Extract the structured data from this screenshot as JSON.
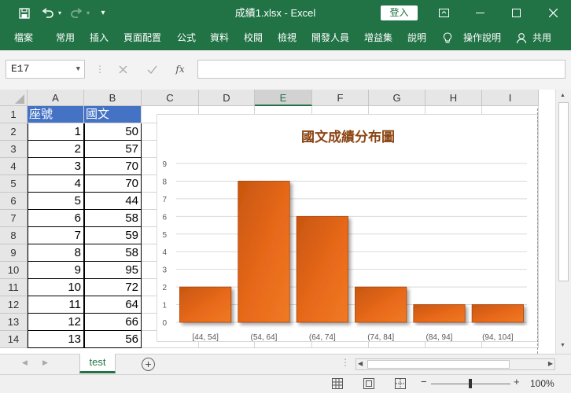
{
  "app": {
    "title": "成績1.xlsx  -  Excel",
    "signin_label": "登入"
  },
  "ribbon": {
    "tabs": [
      "檔案",
      "常用",
      "插入",
      "頁面配置",
      "公式",
      "資料",
      "校閱",
      "檢視",
      "開發人員",
      "增益集",
      "說明",
      "操作說明",
      "共用"
    ]
  },
  "formula_bar": {
    "name_box": "E17",
    "fx_label": "fx",
    "formula": ""
  },
  "grid": {
    "columns": [
      "A",
      "B",
      "C",
      "D",
      "E",
      "F",
      "G",
      "H",
      "I"
    ],
    "selected_column": "E",
    "rows": [
      "1",
      "2",
      "3",
      "4",
      "5",
      "6",
      "7",
      "8",
      "9",
      "10",
      "11",
      "12",
      "13",
      "14"
    ],
    "header_row": [
      "座號",
      "國文"
    ],
    "data": [
      [
        "1",
        "50"
      ],
      [
        "2",
        "57"
      ],
      [
        "3",
        "70"
      ],
      [
        "4",
        "70"
      ],
      [
        "5",
        "44"
      ],
      [
        "6",
        "58"
      ],
      [
        "7",
        "59"
      ],
      [
        "8",
        "58"
      ],
      [
        "9",
        "95"
      ],
      [
        "10",
        "72"
      ],
      [
        "11",
        "64"
      ],
      [
        "12",
        "66"
      ],
      [
        "13",
        "56"
      ]
    ]
  },
  "chart_data": {
    "type": "bar",
    "title": "國文成績分布圖",
    "categories": [
      "[44, 54]",
      "(54, 64]",
      "(64, 74]",
      "(74, 84]",
      "(84, 94]",
      "(94, 104]"
    ],
    "values": [
      2,
      8,
      6,
      2,
      1,
      1
    ],
    "ylim": [
      0,
      9
    ],
    "yticks": [
      "0",
      "1",
      "2",
      "3",
      "4",
      "5",
      "6",
      "7",
      "8",
      "9"
    ],
    "grid": true,
    "colors": {
      "bar": "#e8691a",
      "bar_dark": "#c0500f",
      "title": "#8b4513"
    }
  },
  "sheets": {
    "active": "test"
  },
  "status": {
    "zoom": "100%"
  },
  "colors": {
    "accent": "#217346",
    "header_fill": "#4472c4"
  }
}
